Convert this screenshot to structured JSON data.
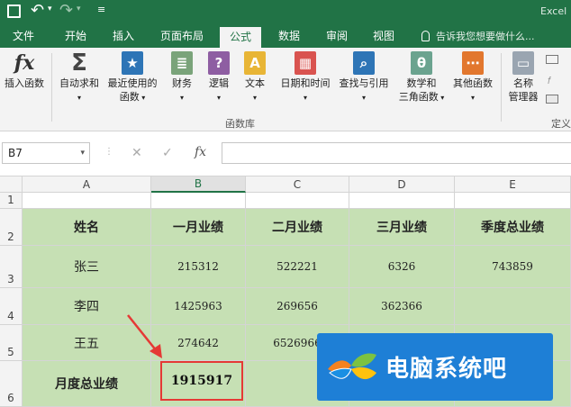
{
  "qat": {
    "undo_icon": "undo-icon",
    "more": "⌄"
  },
  "title_right": "Excel",
  "tabs": [
    "文件",
    "开始",
    "插入",
    "页面布局",
    "公式",
    "数据",
    "审阅",
    "视图"
  ],
  "active_tab": "公式",
  "tellme": "告诉我您想要做什么...",
  "ribbon": {
    "insert_fn": "插入函数",
    "autosum": "自动求和",
    "recent_l1": "最近使用的",
    "recent_l2": "函数",
    "finance": "财务",
    "logic": "逻辑",
    "text": "文本",
    "datetime": "日期和时间",
    "lookup": "查找与引用",
    "math_l1": "数学和",
    "math_l2": "三角函数",
    "other": "其他函数",
    "names_l1": "名称",
    "names_l2": "管理器",
    "group_label": "函数库",
    "right_label": "定义"
  },
  "formula": {
    "namebox": "B7",
    "fx": "fx",
    "cancel": "✕",
    "confirm": "✓",
    "value": ""
  },
  "columns": [
    "A",
    "B",
    "C",
    "D",
    "E"
  ],
  "rows": [
    "1",
    "2",
    "3",
    "4",
    "5",
    "6"
  ],
  "grid": {
    "headers": [
      "姓名",
      "一月业绩",
      "二月业绩",
      "三月业绩",
      "季度总业绩"
    ],
    "r3": [
      "张三",
      "215312",
      "522221",
      "6326",
      "743859"
    ],
    "r4": [
      "李四",
      "1425963",
      "269656",
      "362366",
      ""
    ],
    "r5": [
      "王五",
      "274642",
      "6526966",
      "",
      ""
    ],
    "r6": [
      "月度总业绩",
      "1915917",
      "",
      "",
      ""
    ]
  },
  "watermark": "电脑系统吧",
  "colors": {
    "green": "#217346",
    "cell_green": "#c6e0b4",
    "highlight": "#e53935"
  }
}
